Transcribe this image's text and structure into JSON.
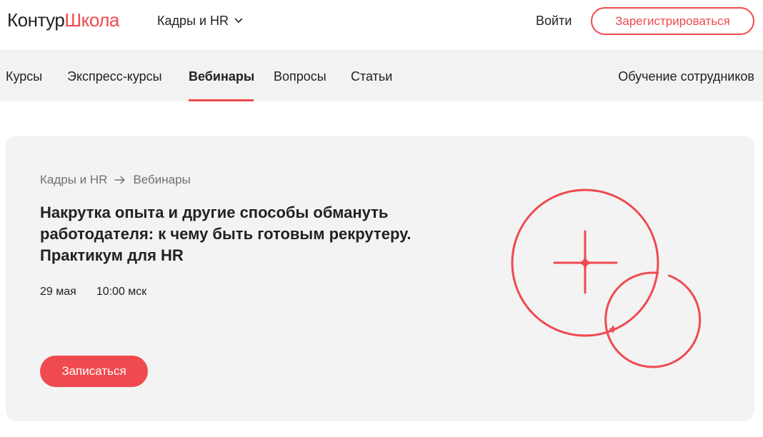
{
  "header": {
    "logo_part1": "Контур",
    "logo_part2": "Школа",
    "section_selector": "Кадры и HR",
    "login_label": "Войти",
    "register_label": "Зарегистрироваться"
  },
  "nav": {
    "items": [
      {
        "label": "Курсы"
      },
      {
        "label": "Экспресс-курсы"
      },
      {
        "label": "Вебинары",
        "active": true
      },
      {
        "label": "Вопросы"
      },
      {
        "label": "Статьи"
      }
    ],
    "right_item": "Обучение сотрудников"
  },
  "hero": {
    "breadcrumb": [
      "Кадры и HR",
      "Вебинары"
    ],
    "title": "Накрутка опыта и другие способы обмануть работодателя: к чему быть готовым рекрутеру. Практикум для HR",
    "date": "29 мая",
    "time": "10:00 мск",
    "signup_label": "Записаться"
  },
  "colors": {
    "accent": "#ee4a4f",
    "nav_background": "#f2f2f2",
    "card_background": "#f3f3f3",
    "text": "#222222",
    "muted_text": "#707070"
  },
  "icons": {
    "selector": "chevron-down-icon",
    "breadcrumb_separator": "arrow-right-icon",
    "illustration": "circles-crosshair-illustration"
  }
}
